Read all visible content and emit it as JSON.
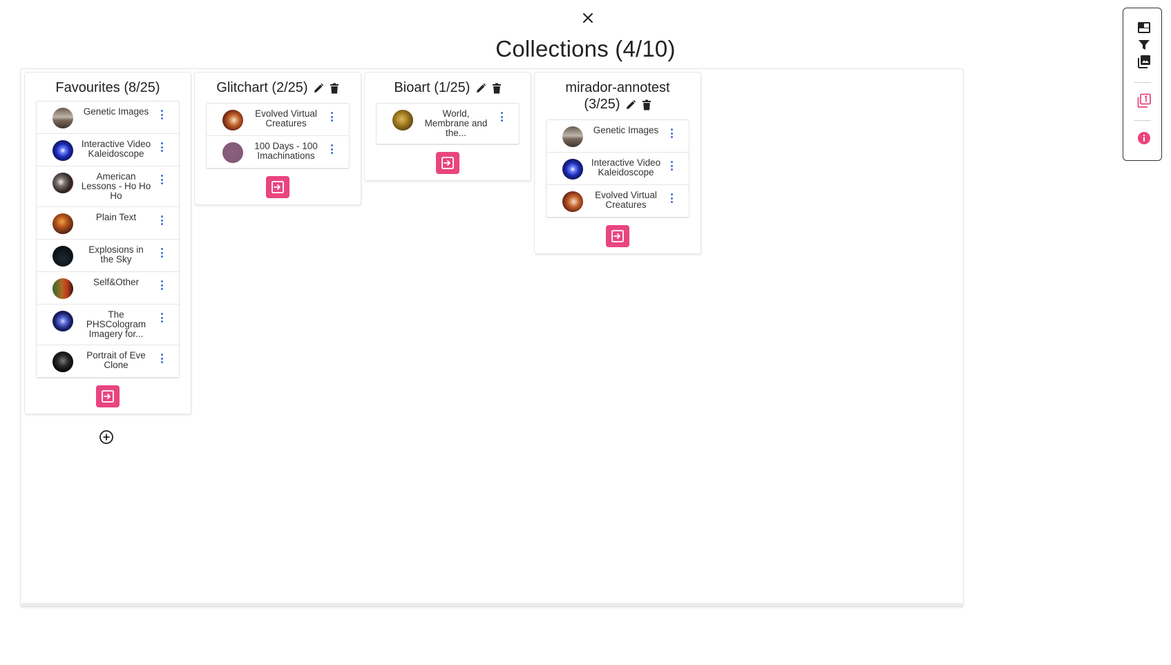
{
  "title": "Collections (4/10)",
  "colors": {
    "accent": "#e9457f",
    "menu_dots": "#3b6fd8"
  },
  "icons": {
    "close": "close-icon",
    "edit": "pencil-icon",
    "delete": "trash-icon",
    "menu": "more-vertical-icon",
    "open": "open-collection-icon",
    "add": "add-circle-icon",
    "side": [
      "layout-icon",
      "filter-icon",
      "image-library-icon",
      "collection-badge-icon",
      "info-icon"
    ]
  },
  "collections": [
    {
      "name": "Favourites",
      "count": "(8/25)",
      "heading": "Favourites (8/25)",
      "editable": false,
      "items": [
        {
          "label": "Genetic Images",
          "thumb": "linear-gradient(180deg,#6a5a4e 0%,#bdb6ac 45%,#7d6a5a 60%,#3c3430 100%)"
        },
        {
          "label": "Interactive Video Kaleidoscope",
          "thumb": "radial-gradient(circle at 50% 50%,#ffffff 0%,#6b7dff 18%,#1a2bb0 45%,#0b0b40 80%)"
        },
        {
          "label": "American Lessons - Ho Ho Ho",
          "thumb": "radial-gradient(circle at 40% 45%,#f0ecea 0%,#7a6f6c 25%,#2b2222 60%,#a03030 100%)"
        },
        {
          "label": "Plain Text",
          "thumb": "radial-gradient(circle at 45% 40%,#f0a040 0%,#b0501a 35%,#4a2010 75%)"
        },
        {
          "label": "Explosions in the Sky",
          "thumb": "radial-gradient(circle at 50% 60%,#1e2a30 0%,#0a1218 60%,#060a0c 100%)"
        },
        {
          "label": "Self&Other",
          "thumb": "linear-gradient(90deg,#2e6a2a 0%,#b06a28 45%,#c23a1a 70%,#2a1a10 100%)"
        },
        {
          "label": "The PHSCologram Imagery for...",
          "thumb": "radial-gradient(circle at 50% 50%,#d6d6ff 0%,#5a6fd8 22%,#1a1f6a 55%,#0a0c2a 90%)"
        },
        {
          "label": "Portrait of Eve Clone",
          "thumb": "radial-gradient(circle at 50% 45%,#7c7c7c 0%,#2a2a2a 35%,#050505 70%)"
        }
      ]
    },
    {
      "name": "Glitchart",
      "count": "(2/25)",
      "heading": "Glitchart (2/25)",
      "editable": true,
      "items": [
        {
          "label": "Evolved Virtual Creatures",
          "thumb": "radial-gradient(circle at 55% 50%,#f3e3c8 0%,#c4622a 35%,#6a2414 70%)"
        },
        {
          "label": "100 Days - 100 Imachinations",
          "thumb": "radial-gradient(circle at 50% 50%,#8d6080 0%,#7e5674 100%)"
        }
      ]
    },
    {
      "name": "Bioart",
      "count": "(1/25)",
      "heading": "Bioart (1/25)",
      "editable": true,
      "items": [
        {
          "label": "World, Membrane and the...",
          "thumb": "radial-gradient(circle at 45% 45%,#e0b860 0%,#a07820 40%,#4e3a10 80%)"
        }
      ]
    },
    {
      "name": "mirador-annotest",
      "count": "(3/25)",
      "heading": "mirador-annotest",
      "heading_line2": "(3/25)",
      "editable": true,
      "items": [
        {
          "label": "Genetic Images",
          "thumb": "linear-gradient(180deg,#6a5a4e 0%,#bdb6ac 45%,#7d6a5a 60%,#3c3430 100%)"
        },
        {
          "label": "Interactive Video Kaleidoscope",
          "thumb": "radial-gradient(circle at 50% 50%,#ffffff 0%,#6b7dff 18%,#1a2bb0 45%,#0b0b40 80%)"
        },
        {
          "label": "Evolved Virtual Creatures",
          "thumb": "radial-gradient(circle at 55% 50%,#f3e3c8 0%,#c4622a 35%,#6a2414 70%)"
        }
      ]
    }
  ]
}
